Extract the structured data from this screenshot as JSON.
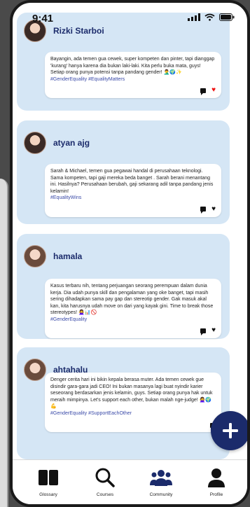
{
  "status_bar": {
    "time": "9:41"
  },
  "posts": [
    {
      "username": "Rizki Starboi",
      "text": "Bayangin, ada temen gua cewek, super kompeten dan pinter, tapi dianggap 'kurang' hanya karena dia bukan laki-laki. Kita perlu buka mata, guys! Setiap orang punya potensi tanpa pandang gender! 🤦‍♂️🌍✨",
      "tags": "#GenderEquality #EqualityMatters",
      "liked": true
    },
    {
      "username": "atyan ajg",
      "text": "Sarah & Michael, temen gua pegawai handal di perusahaan teknologi. Sama kompeten, tapi gaji mereka beda banget . Sarah berani menantang ini. Hasilnya? Perusahaan berubah, gaji sekarang adil tanpa pandang jenis kelamin!",
      "tags": "#EqualityWins",
      "liked": false
    },
    {
      "username": "hamala",
      "text": "Kasus terbaru nih, tentang perjuangan seorang perempuan dalam dunia kerja. Dia udah punya skill dan pengalaman yang oke banget, tapi masih sering dihadapkan sama pay gap dan stereotip gender. Gak masuk akal kan, kita harusnya udah move on dari yang kayak gini. Time to break those stereotypes! 🙅‍♀️📊🚫",
      "tags": "#GenderEquality",
      "liked": false
    },
    {
      "username": "ahtahalu",
      "text": "Denger cerita hari ini bikin kepala berasa muter. Ada temen cewek gue disindir gara-gara jadi CEO! Ini bukan masanya lagi buat nyindir karier seseorang berdasarkan jenis kelamin, guys. Setiap orang punya hak untuk meraih mimpinya. Let's support each other, bukan malah nge-judge! 🙅‍♀️🌍💪",
      "tags": "#GenderEquality #SupportEachOther",
      "liked": false
    }
  ],
  "nav": {
    "glossary": "Glossary",
    "courses": "Courses",
    "community": "Community",
    "profile": "Profile"
  },
  "colors": {
    "accent": "#1b2b6b",
    "card_bg": "#d5e6f5",
    "liked": "#e11111"
  }
}
